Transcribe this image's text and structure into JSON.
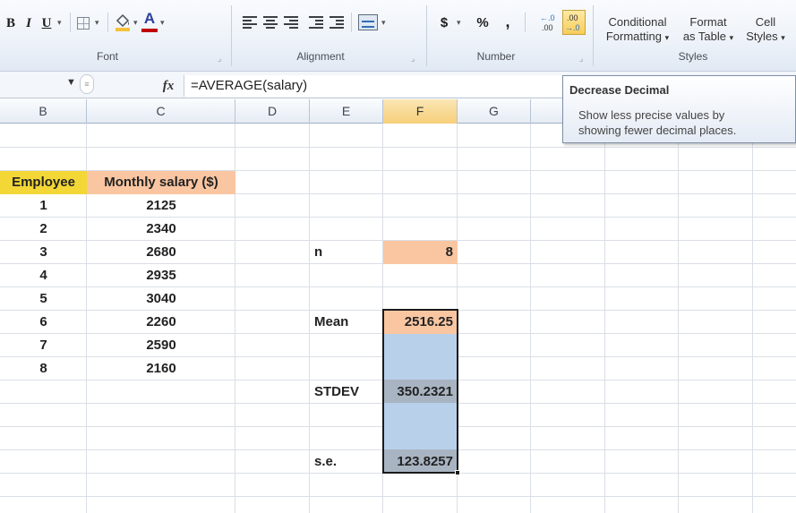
{
  "ribbon": {
    "font": {
      "group_label": "Font",
      "bold": "B",
      "italic": "I",
      "underline": "U",
      "font_color_letter": "A"
    },
    "alignment": {
      "group_label": "Alignment"
    },
    "number": {
      "group_label": "Number",
      "currency": "$",
      "percent": "%",
      "comma": ",",
      "increase_decimal": "+.0\n.00",
      "decrease_decimal": ".00\n→.0"
    },
    "styles": {
      "group_label": "Styles",
      "conditional_formatting_line1": "Conditional",
      "conditional_formatting_line2": "Formatting",
      "format_as_table_line1": "Format",
      "format_as_table_line2": "as Table",
      "cell_styles_line1": "Cell",
      "cell_styles_line2": "Styles"
    },
    "dropdown_arrow": "▾",
    "colors": {
      "font_color": "#c00000",
      "fill_color": "#f5c23c"
    }
  },
  "formula_bar": {
    "fx_label": "fx",
    "formula": "=AVERAGE(salary)"
  },
  "tooltip": {
    "title": "Decrease Decimal",
    "line1": "Show less precise values by",
    "line2": "showing fewer decimal places."
  },
  "columns": [
    "B",
    "C",
    "D",
    "E",
    "F",
    "G"
  ],
  "table": {
    "header_employee": "Employee",
    "header_salary": "Monthly salary ($)",
    "rows": [
      {
        "employee": "1",
        "salary": "2125"
      },
      {
        "employee": "2",
        "salary": "2340"
      },
      {
        "employee": "3",
        "salary": "2680"
      },
      {
        "employee": "4",
        "salary": "2935"
      },
      {
        "employee": "5",
        "salary": "3040"
      },
      {
        "employee": "6",
        "salary": "2260"
      },
      {
        "employee": "7",
        "salary": "2590"
      },
      {
        "employee": "8",
        "salary": "2160"
      }
    ],
    "colors": {
      "employee_header": "#f3d736",
      "salary_header": "#f9c6a1",
      "stat_value": "#f9c6a1",
      "selection": "#b8d0ea",
      "selection_gray": "#a9b4c2"
    }
  },
  "stats": {
    "n_label": "n",
    "n_value": "8",
    "mean_label": "Mean",
    "mean_value": "2516.25",
    "stdev_label": "STDEV",
    "stdev_value": "350.2321",
    "se_label": "s.e.",
    "se_value": "123.8257"
  }
}
